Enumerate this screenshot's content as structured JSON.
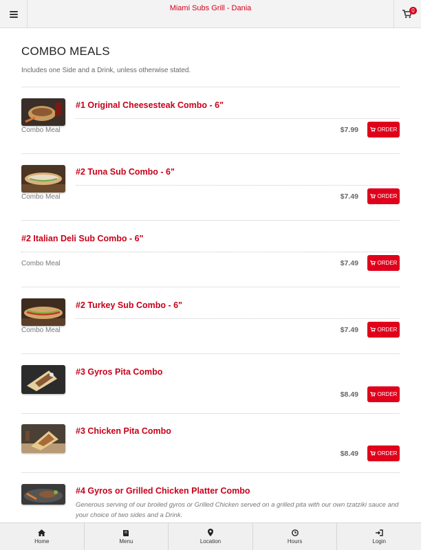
{
  "header": {
    "title": "Miami Subs Grill - Dania",
    "cart_count": "0"
  },
  "section": {
    "title": "COMBO MEALS",
    "subtitle": "Includes one Side and a Drink, unless otherwise stated."
  },
  "order_label": "ORDER",
  "items": [
    {
      "name": "#1 Original Cheesesteak Combo - 6\"",
      "category": "Combo Meal",
      "price": "$7.99",
      "thumb": "cheesesteak"
    },
    {
      "name": "#2 Tuna Sub Combo - 6\"",
      "category": "Combo Meal",
      "price": "$7.49",
      "thumb": "tuna"
    },
    {
      "name": "#2 Italian Deli Sub Combo - 6\"",
      "category": "Combo Meal",
      "price": "$7.49",
      "thumb": ""
    },
    {
      "name": "#2 Turkey Sub Combo - 6\"",
      "category": "Combo Meal",
      "price": "$7.49",
      "thumb": "turkey"
    },
    {
      "name": "#3 Gyros Pita Combo",
      "category": "",
      "price": "$8.49",
      "thumb": "gyros"
    },
    {
      "name": "#3 Chicken Pita Combo",
      "category": "",
      "price": "$8.49",
      "thumb": "chicken-pita"
    },
    {
      "name": "#4 Gyros or Grilled Chicken Platter Combo",
      "description": "Generous serving of our broiled gyros or Grilled Chicken served on a grilled pita with our own tzatziki sauce and your choice of two sides and a Drink.",
      "thumb": "platter"
    }
  ],
  "nav": [
    {
      "label": "Home",
      "icon": "home-icon"
    },
    {
      "label": "Menu",
      "icon": "book-icon"
    },
    {
      "label": "Location",
      "icon": "map-marker-icon"
    },
    {
      "label": "Hours",
      "icon": "clock-icon"
    },
    {
      "label": "Login",
      "icon": "login-icon"
    }
  ],
  "colors": {
    "accent": "#e0001b",
    "item_title": "#c8001a",
    "header_bg": "#f3f3f3"
  }
}
